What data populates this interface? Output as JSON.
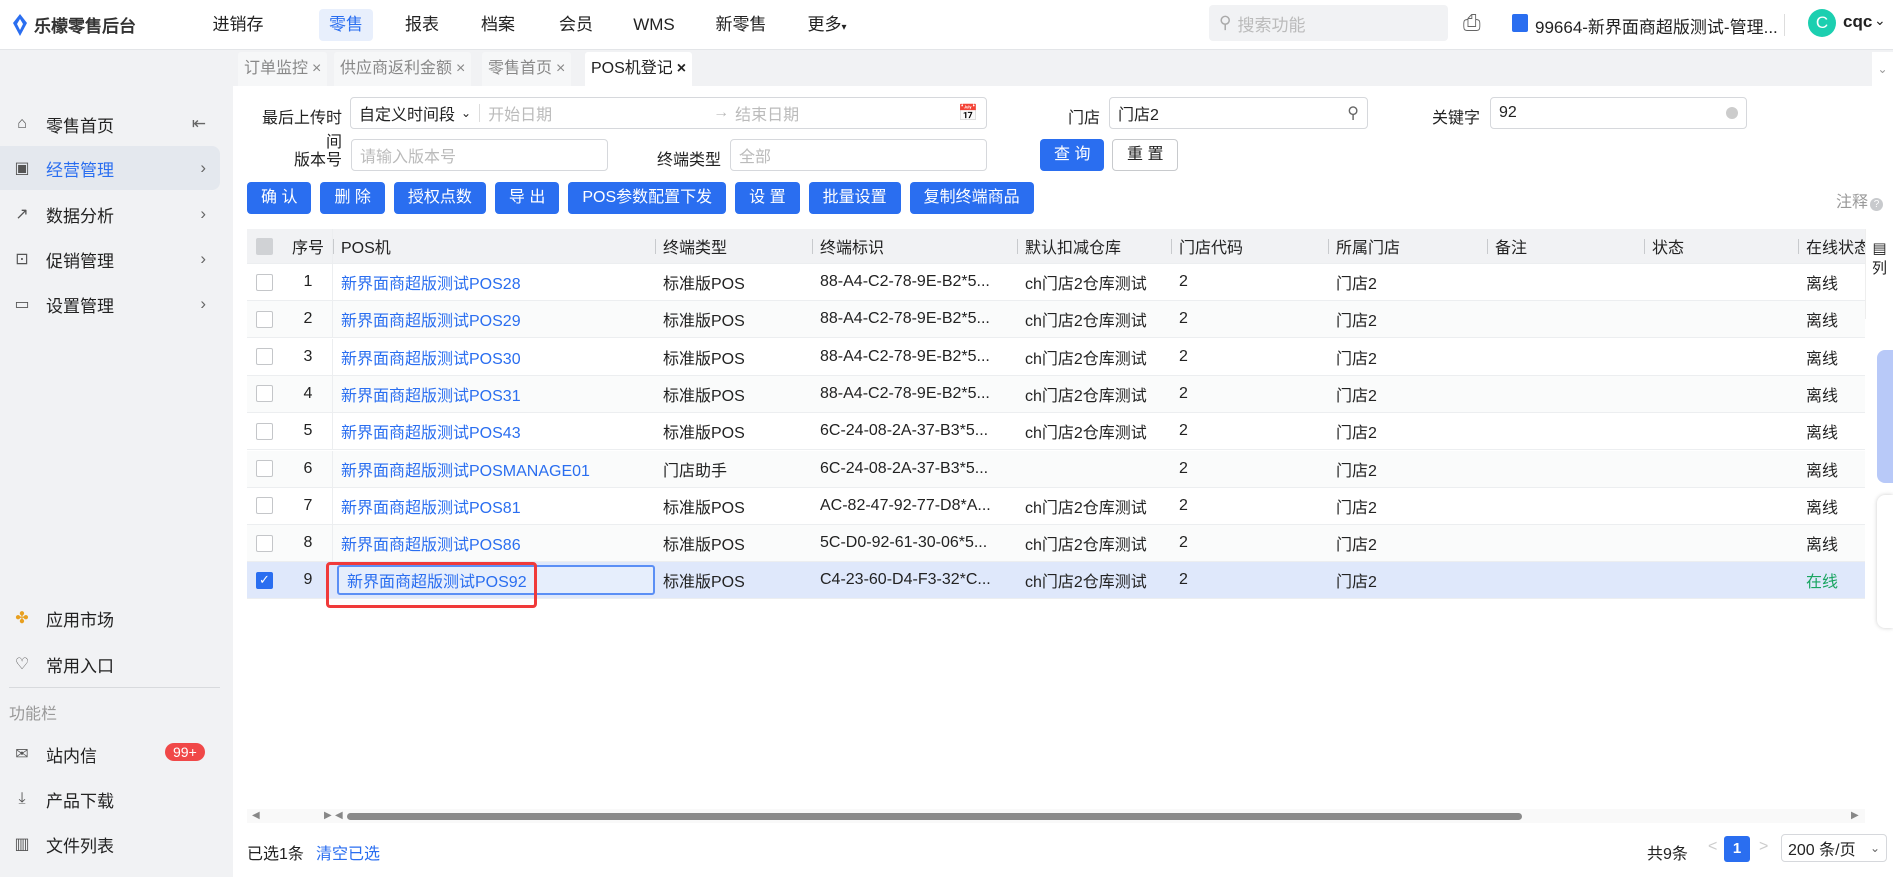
{
  "app": {
    "title": "乐檬零售后台"
  },
  "topnav": [
    {
      "label": "进销存"
    },
    {
      "label": "零售",
      "active": true
    },
    {
      "label": "报表"
    },
    {
      "label": "档案"
    },
    {
      "label": "会员"
    },
    {
      "label": "WMS"
    },
    {
      "label": "新零售"
    },
    {
      "label": "更多"
    }
  ],
  "search": {
    "placeholder": "搜索功能"
  },
  "store": {
    "name": "99664-新界面商超版测试-管理..."
  },
  "user": {
    "initial": "C",
    "name": "cqc"
  },
  "sidebar": {
    "items": [
      {
        "label": "零售首页",
        "icon": "home-icon"
      },
      {
        "label": "经营管理",
        "icon": "monitor-icon",
        "active": true
      },
      {
        "label": "数据分析",
        "icon": "chart-icon"
      },
      {
        "label": "促销管理",
        "icon": "promo-icon"
      },
      {
        "label": "设置管理",
        "icon": "folder-icon"
      }
    ],
    "bottom": [
      {
        "label": "应用市场"
      },
      {
        "label": "常用入口"
      }
    ],
    "section": "功能栏",
    "tools": [
      {
        "label": "站内信",
        "badge": "99+"
      },
      {
        "label": "产品下载"
      },
      {
        "label": "文件列表"
      }
    ]
  },
  "tabs": [
    {
      "label": "订单监控"
    },
    {
      "label": "供应商返利金额"
    },
    {
      "label": "零售首页"
    },
    {
      "label": "POS机登记",
      "active": true
    }
  ],
  "filters": {
    "upload_time_label": "最后上传时间",
    "upload_time_mode": "自定义时间段",
    "start_placeholder": "开始日期",
    "end_placeholder": "结束日期",
    "store_label": "门店",
    "store_value": "门店2",
    "keyword_label": "关键字",
    "keyword_value": "92",
    "version_label": "版本号",
    "version_placeholder": "请输入版本号",
    "terminal_type_label": "终端类型",
    "terminal_type_placeholder": "全部",
    "query": "查 询",
    "reset": "重 置"
  },
  "toolbar": [
    "确 认",
    "删 除",
    "授权点数",
    "导 出",
    "POS参数配置下发",
    "设 置",
    "批量设置",
    "复制终端商品"
  ],
  "note": "注释",
  "table": {
    "columns": [
      "序号",
      "POS机",
      "终端类型",
      "终端标识",
      "默认扣减仓库",
      "门店代码",
      "所属门店",
      "备注",
      "状态",
      "在线状态"
    ],
    "column_settings": "列",
    "rows": [
      {
        "no": "1",
        "pos": "新界面商超版测试POS28",
        "type": "标准版POS",
        "id": "88-A4-C2-78-9E-B2*5...",
        "wh": "ch门店2仓库测试",
        "code": "2",
        "store": "门店2",
        "remark": "",
        "status": "",
        "online": "离线"
      },
      {
        "no": "2",
        "pos": "新界面商超版测试POS29",
        "type": "标准版POS",
        "id": "88-A4-C2-78-9E-B2*5...",
        "wh": "ch门店2仓库测试",
        "code": "2",
        "store": "门店2",
        "remark": "",
        "status": "",
        "online": "离线"
      },
      {
        "no": "3",
        "pos": "新界面商超版测试POS30",
        "type": "标准版POS",
        "id": "88-A4-C2-78-9E-B2*5...",
        "wh": "ch门店2仓库测试",
        "code": "2",
        "store": "门店2",
        "remark": "",
        "status": "",
        "online": "离线"
      },
      {
        "no": "4",
        "pos": "新界面商超版测试POS31",
        "type": "标准版POS",
        "id": "88-A4-C2-78-9E-B2*5...",
        "wh": "ch门店2仓库测试",
        "code": "2",
        "store": "门店2",
        "remark": "",
        "status": "",
        "online": "离线"
      },
      {
        "no": "5",
        "pos": "新界面商超版测试POS43",
        "type": "标准版POS",
        "id": "6C-24-08-2A-37-B3*5...",
        "wh": "ch门店2仓库测试",
        "code": "2",
        "store": "门店2",
        "remark": "",
        "status": "",
        "online": "离线"
      },
      {
        "no": "6",
        "pos": "新界面商超版测试POSMANAGE01",
        "type": "门店助手",
        "id": "6C-24-08-2A-37-B3*5...",
        "wh": "",
        "code": "2",
        "store": "门店2",
        "remark": "",
        "status": "",
        "online": "离线"
      },
      {
        "no": "7",
        "pos": "新界面商超版测试POS81",
        "type": "标准版POS",
        "id": "AC-82-47-92-77-D8*A...",
        "wh": "ch门店2仓库测试",
        "code": "2",
        "store": "门店2",
        "remark": "",
        "status": "",
        "online": "离线"
      },
      {
        "no": "8",
        "pos": "新界面商超版测试POS86",
        "type": "标准版POS",
        "id": "5C-D0-92-61-30-06*5...",
        "wh": "ch门店2仓库测试",
        "code": "2",
        "store": "门店2",
        "remark": "",
        "status": "",
        "online": "离线"
      },
      {
        "no": "9",
        "pos": "新界面商超版测试POS92",
        "type": "标准版POS",
        "id": "C4-23-60-D4-F3-32*C...",
        "wh": "ch门店2仓库测试",
        "code": "2",
        "store": "门店2",
        "remark": "",
        "status": "",
        "online": "在线",
        "selected": true
      }
    ]
  },
  "footer": {
    "selected": "已选1条",
    "clear": "清空已选",
    "total": "共9条",
    "page": "1",
    "page_size": "200 条/页"
  },
  "colors": {
    "accent": "#2a6ef0",
    "online": "#19a561",
    "badge": "#f04848",
    "highlight": "#f03a3a"
  }
}
